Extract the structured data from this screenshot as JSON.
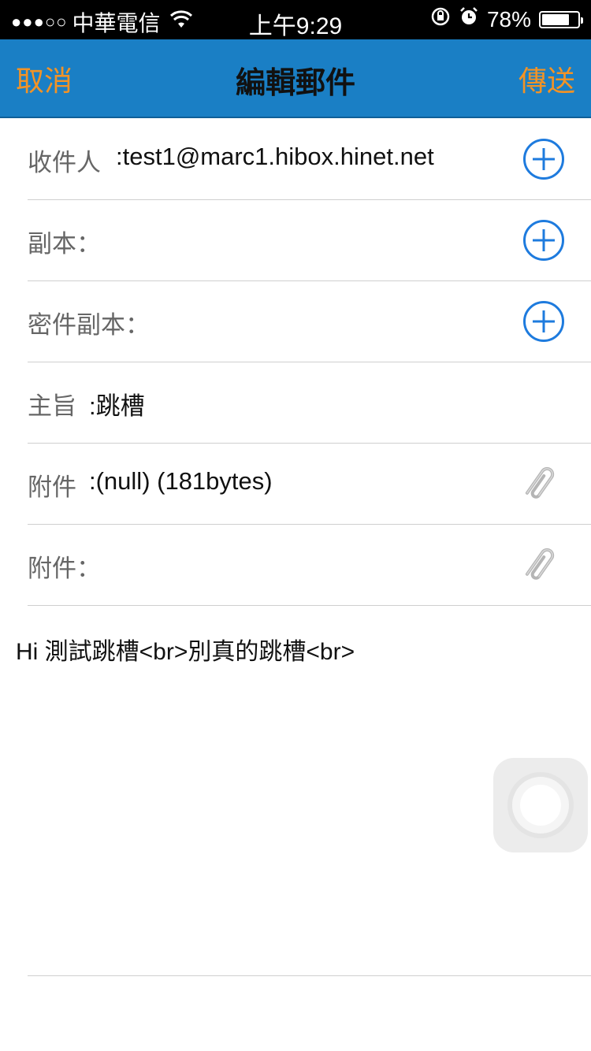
{
  "status_bar": {
    "signal": "●●●○○",
    "carrier": "中華電信",
    "time": "上午9:29",
    "battery": "78%",
    "battery_level": 0.78
  },
  "nav": {
    "cancel": "取消",
    "title": "編輯郵件",
    "send": "傳送",
    "bar_color": "#1a7fc5",
    "action_color": "#f39325"
  },
  "fields": {
    "to_label": "收件人",
    "to_value": ":test1@marc1.hibox.hinet.net",
    "cc_label": "副本：",
    "bcc_label": "密件副本：",
    "subject_label": "主旨",
    "subject_value": ":跳槽",
    "attachment1_label": "附件",
    "attachment1_value": ":(null) (181bytes)",
    "attachment2_label": "附件："
  },
  "body": {
    "text": "Hi 測試跳槽<br>別真的跳槽<br>"
  }
}
